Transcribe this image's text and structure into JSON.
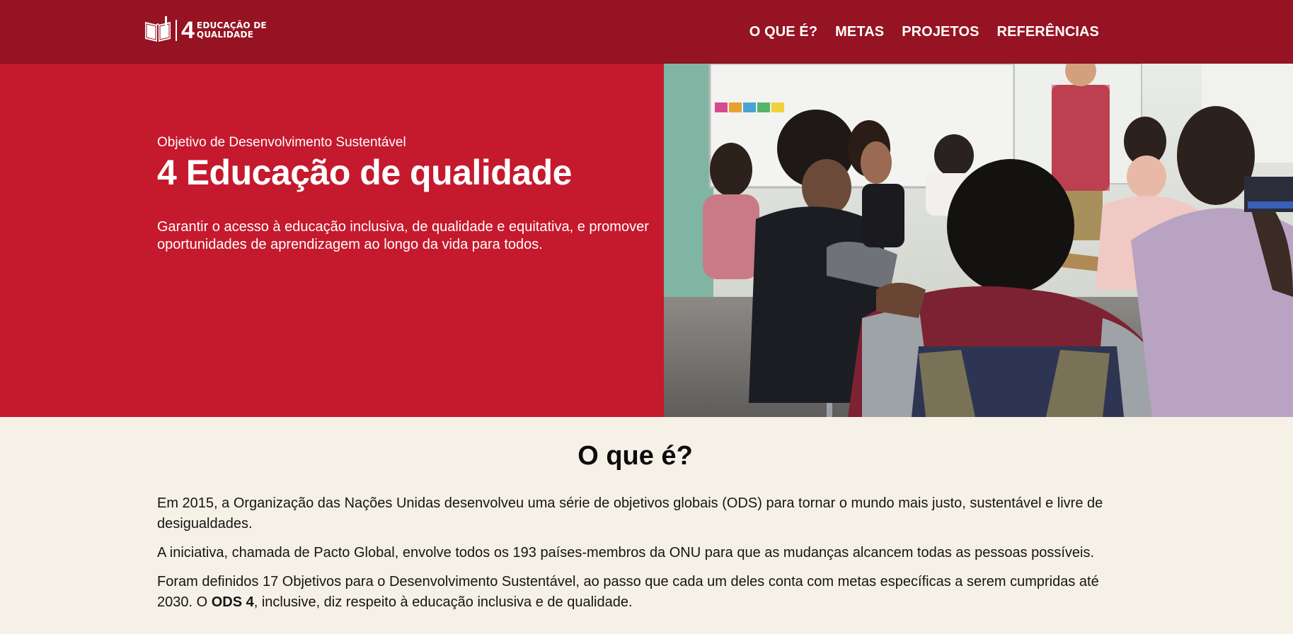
{
  "header": {
    "logo": {
      "number": "4",
      "line1": "EDUCAÇÃO DE",
      "line2": "QUALIDADE"
    },
    "nav": [
      {
        "label": "O QUE É?"
      },
      {
        "label": "METAS"
      },
      {
        "label": "PROJETOS"
      },
      {
        "label": "REFERÊNCIAS"
      }
    ]
  },
  "hero": {
    "kicker": "Objetivo de Desenvolvimento Sustentável",
    "title": "4 Educação de qualidade",
    "description": "Garantir o acesso à educação inclusiva, de qualidade e equitativa, e promover oportunidades de aprendizagem ao longo da vida para todos.",
    "image_icon": "classroom-photo"
  },
  "about": {
    "title": "O que é?",
    "p1": "Em 2015, a Organização das Nações Unidas desenvolveu uma série de objetivos globais (ODS) para tornar o mundo mais justo, sustentável e livre de desigualdades.",
    "p2": "A iniciativa, chamada de Pacto Global, envolve todos os 193 países-membros da ONU para que as mudanças alcancem todas as pessoas possíveis.",
    "p3_before": "Foram definidos 17 Objetivos para o Desenvolvimento Sustentável, ao passo que cada um deles conta com metas específicas a serem cumpridas até 2030. O ",
    "p3_bold": "ODS 4",
    "p3_after": ", inclusive, diz respeito à educação inclusiva e de qualidade."
  },
  "colors": {
    "header_bg": "#951322",
    "hero_bg": "#c5192d",
    "page_bg": "#f6f1e6",
    "text": "#151515"
  }
}
